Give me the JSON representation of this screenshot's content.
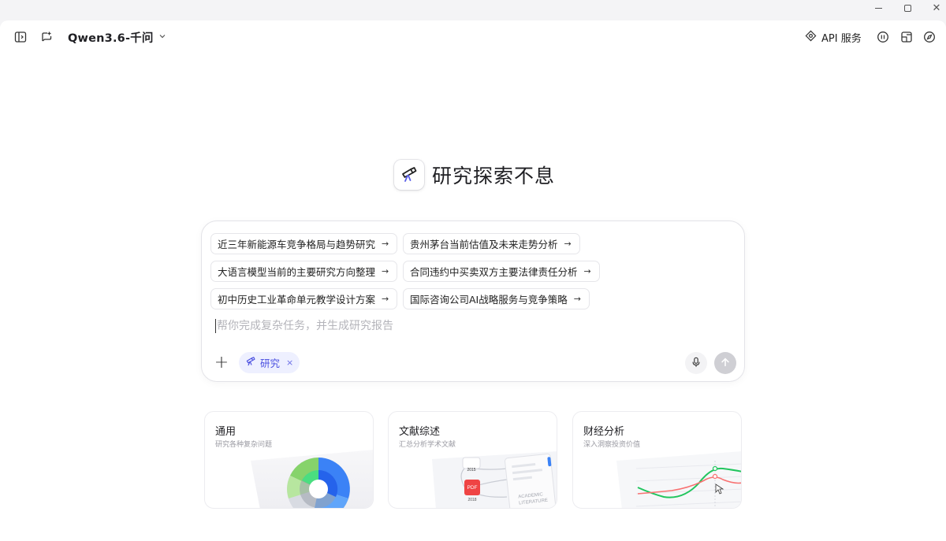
{
  "window": {
    "minimize": "—",
    "maximize": "☐",
    "close": "✕"
  },
  "header": {
    "model_name": "Qwen3.6-千问",
    "api_service": "API 服务",
    "icons": [
      "sidebar-toggle-icon",
      "new-chat-icon",
      "chevron-down-icon",
      "api-icon",
      "history-icon",
      "layout-icon",
      "explore-icon"
    ]
  },
  "hero": {
    "title": "研究探索不息",
    "logo": "telescope-icon"
  },
  "composer": {
    "suggestions": [
      "近三年新能源车竞争格局与趋势研究",
      "贵州茅台当前估值及未来走势分析",
      "大语言模型当前的主要研究方向整理",
      "合同违约中买卖双方主要法律责任分析",
      "初中历史工业革命单元教学设计方案",
      "国际咨询公司AI战略服务与竞争策略"
    ],
    "suggestion_arrow": "→",
    "placeholder": "帮你完成复杂任务，并生成研究报告",
    "mode_tag": "研究",
    "mode_close": "×",
    "plus": "+"
  },
  "cards": [
    {
      "title": "通用",
      "subtitle": "研究各种复杂问题"
    },
    {
      "title": "文献综述",
      "subtitle": "汇总分析学术文献",
      "art_labels": [
        "ACADEMIC",
        "LITERATURE",
        "PDF",
        "2015",
        "2018"
      ]
    },
    {
      "title": "财经分析",
      "subtitle": "深入洞察投资价值"
    }
  ],
  "colors": {
    "accent": "#4a4fe0",
    "accent_bg": "#eef0ff",
    "send_disabled": "#cfcfd4"
  }
}
